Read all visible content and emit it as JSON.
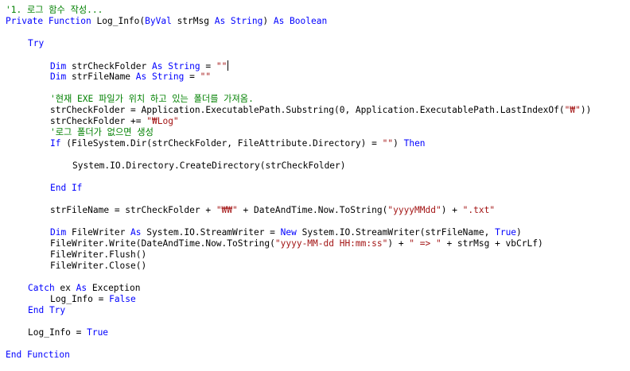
{
  "colors": {
    "background": "#ffffff",
    "keyword": "#0000ff",
    "comment": "#008000",
    "string": "#a31515",
    "text": "#000000"
  },
  "lines": [
    {
      "row": 0,
      "indent": 0,
      "tokens": [
        {
          "t": "cm",
          "v": "'1. 로그 함수 작성..."
        }
      ]
    },
    {
      "row": 1,
      "indent": 0,
      "tokens": [
        {
          "t": "kw",
          "v": "Private Function"
        },
        {
          "t": "tx",
          "v": " Log_Info("
        },
        {
          "t": "kw",
          "v": "ByVal"
        },
        {
          "t": "tx",
          "v": " strMsg "
        },
        {
          "t": "kw",
          "v": "As String"
        },
        {
          "t": "tx",
          "v": ") "
        },
        {
          "t": "kw",
          "v": "As Boolean"
        }
      ]
    },
    {
      "row": 3,
      "indent": 4,
      "tokens": [
        {
          "t": "kw",
          "v": "Try"
        }
      ]
    },
    {
      "row": 5,
      "indent": 8,
      "caret": true,
      "tokens": [
        {
          "t": "kw",
          "v": "Dim"
        },
        {
          "t": "tx",
          "v": " strCheckFolder "
        },
        {
          "t": "kw",
          "v": "As String"
        },
        {
          "t": "tx",
          "v": " = "
        },
        {
          "t": "st",
          "v": "\"\""
        }
      ]
    },
    {
      "row": 6,
      "indent": 8,
      "tokens": [
        {
          "t": "kw",
          "v": "Dim"
        },
        {
          "t": "tx",
          "v": " strFileName "
        },
        {
          "t": "kw",
          "v": "As String"
        },
        {
          "t": "tx",
          "v": " = "
        },
        {
          "t": "st",
          "v": "\"\""
        }
      ]
    },
    {
      "row": 8,
      "indent": 8,
      "tokens": [
        {
          "t": "cm",
          "v": "'현재 EXE 파일가 위치 하고 있는 폴더를 가져옴."
        }
      ]
    },
    {
      "row": 9,
      "indent": 8,
      "tokens": [
        {
          "t": "tx",
          "v": "strCheckFolder = Application.ExecutablePath.Substring(0, Application.ExecutablePath.LastIndexOf("
        },
        {
          "t": "st",
          "v": "\"₩\""
        },
        {
          "t": "tx",
          "v": "))"
        }
      ]
    },
    {
      "row": 10,
      "indent": 8,
      "tokens": [
        {
          "t": "tx",
          "v": "strCheckFolder += "
        },
        {
          "t": "st",
          "v": "\"₩Log\""
        }
      ]
    },
    {
      "row": 11,
      "indent": 8,
      "tokens": [
        {
          "t": "cm",
          "v": "'로그 폴더가 없으면 생성"
        }
      ]
    },
    {
      "row": 12,
      "indent": 8,
      "tokens": [
        {
          "t": "kw",
          "v": "If"
        },
        {
          "t": "tx",
          "v": " (FileSystem.Dir(strCheckFolder, FileAttribute.Directory) = "
        },
        {
          "t": "st",
          "v": "\"\""
        },
        {
          "t": "tx",
          "v": ") "
        },
        {
          "t": "kw",
          "v": "Then"
        }
      ]
    },
    {
      "row": 14,
      "indent": 12,
      "tokens": [
        {
          "t": "tx",
          "v": "System.IO.Directory.CreateDirectory(strCheckFolder)"
        }
      ]
    },
    {
      "row": 16,
      "indent": 8,
      "tokens": [
        {
          "t": "kw",
          "v": "End If"
        }
      ]
    },
    {
      "row": 18,
      "indent": 8,
      "tokens": [
        {
          "t": "tx",
          "v": "strFileName = strCheckFolder + "
        },
        {
          "t": "st",
          "v": "\"₩₩\""
        },
        {
          "t": "tx",
          "v": " + DateAndTime.Now.ToString("
        },
        {
          "t": "st",
          "v": "\"yyyyMMdd\""
        },
        {
          "t": "tx",
          "v": ") + "
        },
        {
          "t": "st",
          "v": "\".txt\""
        }
      ]
    },
    {
      "row": 20,
      "indent": 8,
      "tokens": [
        {
          "t": "kw",
          "v": "Dim"
        },
        {
          "t": "tx",
          "v": " FileWriter "
        },
        {
          "t": "kw",
          "v": "As"
        },
        {
          "t": "tx",
          "v": " System.IO.StreamWriter = "
        },
        {
          "t": "kw",
          "v": "New"
        },
        {
          "t": "tx",
          "v": " System.IO.StreamWriter(strFileName, "
        },
        {
          "t": "kw",
          "v": "True"
        },
        {
          "t": "tx",
          "v": ")"
        }
      ]
    },
    {
      "row": 21,
      "indent": 8,
      "tokens": [
        {
          "t": "tx",
          "v": "FileWriter.Write(DateAndTime.Now.ToString("
        },
        {
          "t": "st",
          "v": "\"yyyy-MM-dd HH:mm:ss\""
        },
        {
          "t": "tx",
          "v": ") + "
        },
        {
          "t": "st",
          "v": "\" => \""
        },
        {
          "t": "tx",
          "v": " + strMsg + vbCrLf)"
        }
      ]
    },
    {
      "row": 22,
      "indent": 8,
      "tokens": [
        {
          "t": "tx",
          "v": "FileWriter.Flush()"
        }
      ]
    },
    {
      "row": 23,
      "indent": 8,
      "tokens": [
        {
          "t": "tx",
          "v": "FileWriter.Close()"
        }
      ]
    },
    {
      "row": 25,
      "indent": 4,
      "tokens": [
        {
          "t": "kw",
          "v": "Catch"
        },
        {
          "t": "tx",
          "v": " ex "
        },
        {
          "t": "kw",
          "v": "As"
        },
        {
          "t": "tx",
          "v": " Exception"
        }
      ]
    },
    {
      "row": 26,
      "indent": 8,
      "tokens": [
        {
          "t": "tx",
          "v": "Log_Info = "
        },
        {
          "t": "kw",
          "v": "False"
        }
      ]
    },
    {
      "row": 27,
      "indent": 4,
      "tokens": [
        {
          "t": "kw",
          "v": "End Try"
        }
      ]
    },
    {
      "row": 29,
      "indent": 4,
      "tokens": [
        {
          "t": "tx",
          "v": "Log_Info = "
        },
        {
          "t": "kw",
          "v": "True"
        }
      ]
    },
    {
      "row": 31,
      "indent": 0,
      "tokens": [
        {
          "t": "kw",
          "v": "End Function"
        }
      ]
    }
  ]
}
